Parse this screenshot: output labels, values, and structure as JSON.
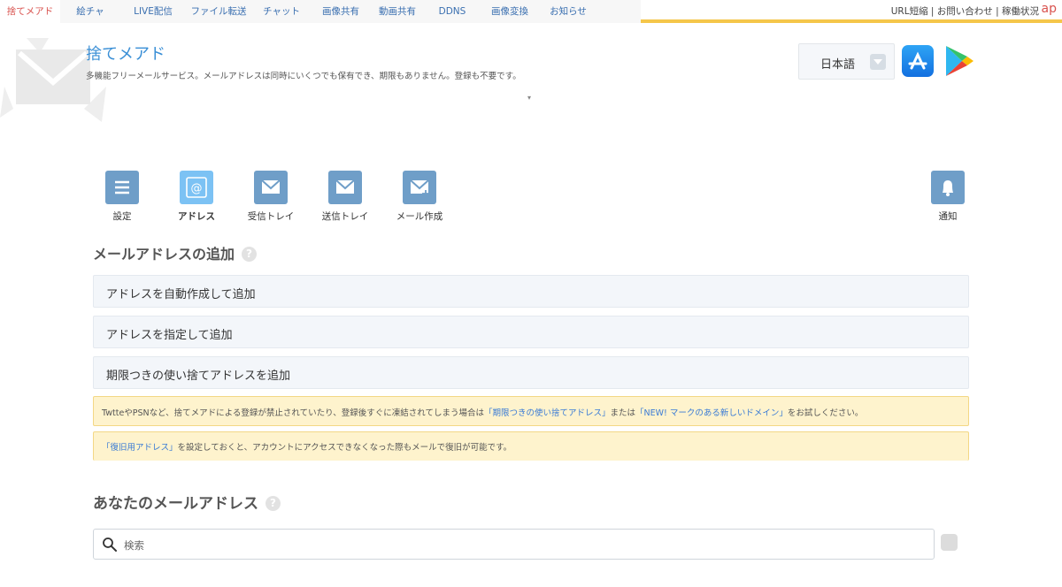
{
  "topnav": {
    "tabs": [
      {
        "label": "捨てメアド",
        "active": true
      },
      {
        "label": "絵チャ"
      },
      {
        "label": "LIVE配信"
      },
      {
        "label": "ファイル転送"
      },
      {
        "label": "チャット"
      },
      {
        "label": "画像共有"
      },
      {
        "label": "動画共有"
      },
      {
        "label": "DDNS"
      },
      {
        "label": "画像変換"
      },
      {
        "label": "お知らせ"
      }
    ],
    "right_links": "URL短縮 | お問い合わせ | 稼働状況",
    "brand": "ap"
  },
  "header": {
    "title": "捨てメアド",
    "description": "多機能フリーメールサービス。メールアドレスは同時にいくつでも保有でき、期限もありません。登録も不要です。",
    "language": "日本語"
  },
  "iconbar": {
    "settings": "設定",
    "address": "アドレス",
    "inbox": "受信トレイ",
    "outbox": "送信トレイ",
    "compose": "メール作成",
    "notify": "通知"
  },
  "add_section": {
    "heading": "メールアドレスの追加",
    "auto": "アドレスを自動作成して追加",
    "specify": "アドレスを指定して追加",
    "limited": "期限つきの使い捨てアドレスを追加"
  },
  "notice1": {
    "pre": "TwtteやPSNなど、捨てメアドによる登録が禁止されていたり、登録後すぐに凍結されてしまう場合は",
    "link1": "「期限つきの使い捨てアドレス」",
    "mid": "または",
    "link2": "「NEW! マークのある新しいドメイン」",
    "post": "をお試しください。"
  },
  "notice2": {
    "link": "「復旧用アドレス」",
    "text": "を設定しておくと、アカウントにアクセスできなくなった際もメールで復旧が可能です。"
  },
  "your_section": {
    "heading": "あなたのメールアドレス",
    "search_placeholder": "検索"
  },
  "colors": {
    "accent": "#3a8fd6",
    "icon_box": "#6f9ec8",
    "icon_box_active": "#7cc2f4",
    "notice_bg": "#fef3cd",
    "nav_underline": "#f5c64a"
  }
}
